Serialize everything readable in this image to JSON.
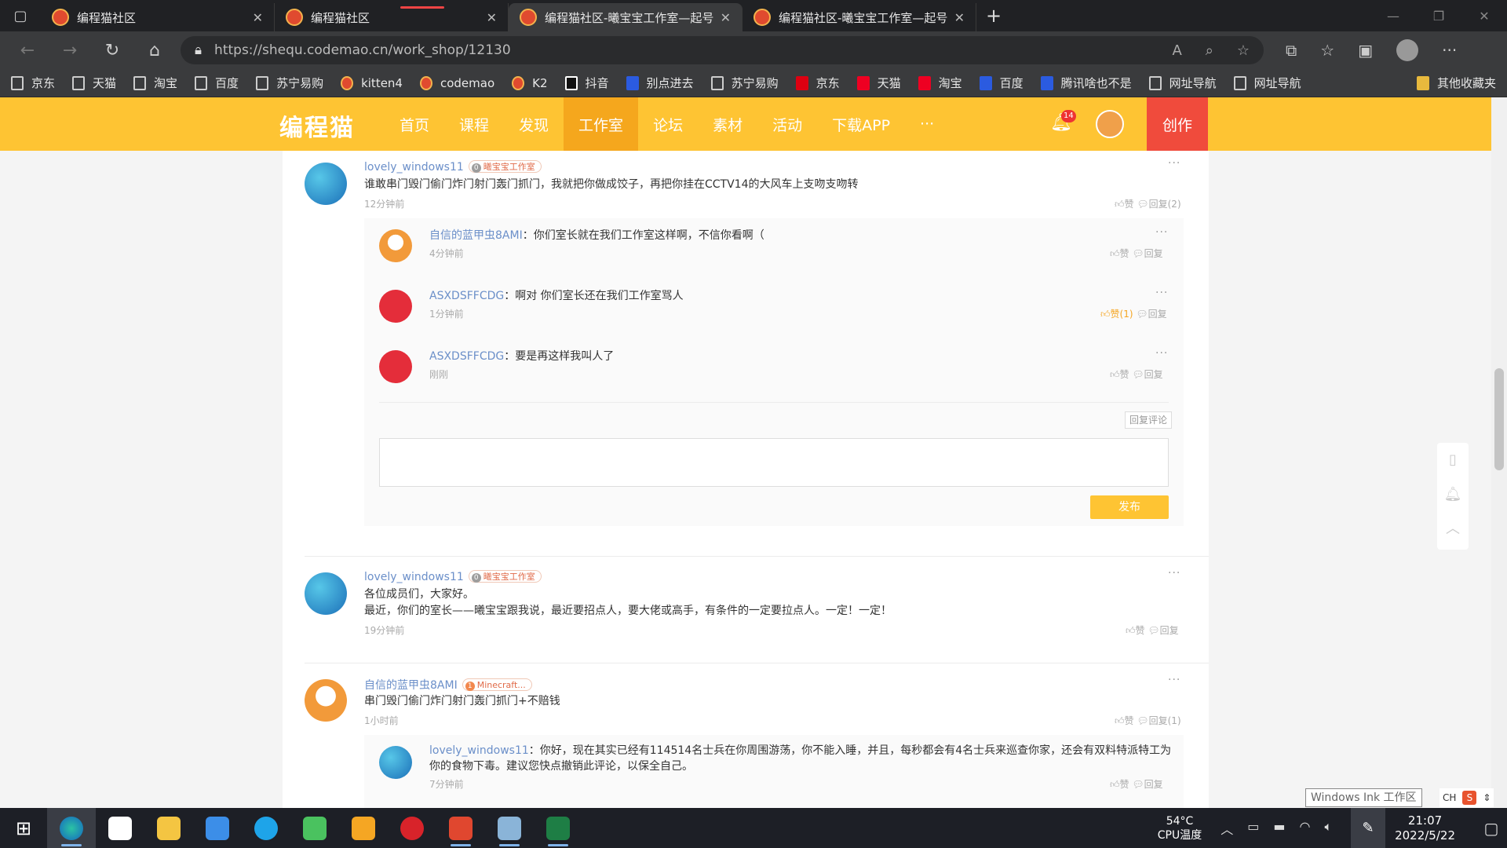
{
  "browser": {
    "tabs": [
      {
        "title": "编程猫社区",
        "active": false
      },
      {
        "title": "编程猫社区",
        "active": false,
        "loading": true
      },
      {
        "title": "编程猫社区-曦宝宝工作室—起号",
        "active": true
      },
      {
        "title": "编程猫社区-曦宝宝工作室—起号",
        "active": false
      }
    ],
    "url": "https://shequ.codemao.cn/work_shop/12130",
    "bookmarks": [
      "京东",
      "天猫",
      "淘宝",
      "百度",
      "苏宁易购",
      "kitten4",
      "codemao",
      "K2",
      "抖音",
      "别点进去",
      "苏宁易购",
      "京东",
      "天猫",
      "淘宝",
      "百度",
      "腾讯啥也不是",
      "网址导航",
      "网址导航"
    ],
    "other_bookmarks": "其他收藏夹"
  },
  "site": {
    "logo": "编程猫",
    "nav": [
      "首页",
      "课程",
      "发现",
      "工作室",
      "论坛",
      "素材",
      "活动",
      "下载APP",
      "···"
    ],
    "notification_count": "14",
    "create_label": "创作"
  },
  "comments": [
    {
      "user": "lovely_windows11",
      "level": "0",
      "tag": "曦宝宝工作室",
      "text": "谁敢串门毁门偷门炸门射门轰门抓门，我就把你做成饺子，再把你挂在CCTV14的大风车上支吻支吻转",
      "time": "12分钟前",
      "like": "赞",
      "reply": "回复(2)",
      "replies": [
        {
          "user": "自信的蓝甲虫8AMI",
          "text": "你们室长就在我们工作室这样啊，不信你看啊（",
          "time": "4分钟前",
          "like": "赞",
          "reply": "回复"
        },
        {
          "user": "ASXDSFFCDG",
          "text": "啊对 你们室长还在我们工作室骂人",
          "time": "1分钟前",
          "like": "赞(1)",
          "reply": "回复"
        },
        {
          "user": "ASXDSFFCDG",
          "text": "要是再这样我叫人了",
          "time": "刚刚",
          "like": "赞",
          "reply": "回复"
        }
      ],
      "reply_comment_label": "回复评论",
      "publish_label": "发布"
    },
    {
      "user": "lovely_windows11",
      "level": "0",
      "tag": "曦宝宝工作室",
      "text_lines": [
        "各位成员们，大家好。",
        "最近，你们的室长——曦宝宝跟我说，最近要招点人，要大佬或高手，有条件的一定要拉点人。一定！一定！"
      ],
      "time": "19分钟前",
      "like": "赞",
      "reply": "回复"
    },
    {
      "user": "自信的蓝甲虫8AMI",
      "level": "1",
      "tag": "Minecraft...",
      "text": "串门毁门偷门炸门射门轰门抓门+不赔钱",
      "time": "1小时前",
      "like": "赞",
      "reply": "回复(1)",
      "replies": [
        {
          "user": "lovely_windows11",
          "text_lines": [
            "你好，现在其实已经有114514名士兵在你周围游荡，你不能入睡，并且，每秒都会有4名士兵来巡查你家，还会有双料特派特工为",
            "你的食物下毒。建议您快点撤销此评论，以保全自己。"
          ],
          "time": "7分钟前",
          "like": "赞",
          "reply": "回复"
        }
      ]
    }
  ],
  "more_label": "···",
  "overlay": {
    "ink_tooltip": "Windows Ink 工作区",
    "ime": "CH"
  },
  "taskbar": {
    "temp": "54°C",
    "temp_label": "CPU温度",
    "time": "21:07",
    "date": "2022/5/22"
  },
  "colors": {
    "site_yellow": "#fec433",
    "nav_active": "#f5a71d",
    "create_red": "#f04b3c",
    "username_blue": "#6b8fc9"
  }
}
